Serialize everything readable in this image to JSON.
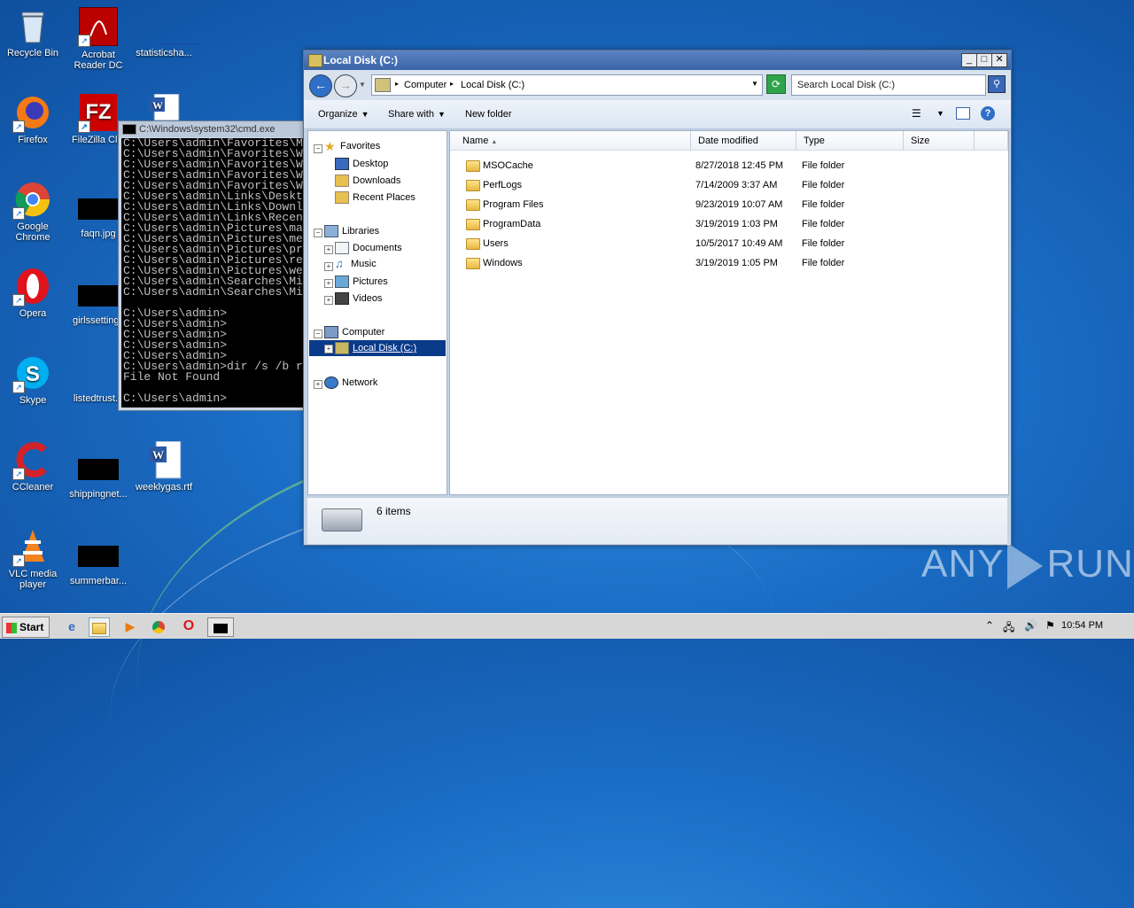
{
  "desktop": {
    "icons": [
      {
        "label": "Recycle Bin",
        "icon": "recycle-bin-icon"
      },
      {
        "label": "Acrobat Reader DC",
        "icon": "acrobat-icon"
      },
      {
        "label": "statisticsha...",
        "icon": "file-icon"
      },
      {
        "label": "Firefox",
        "icon": "firefox-icon"
      },
      {
        "label": "FileZilla Clie",
        "icon": "filezilla-icon"
      },
      {
        "label": "Google Chrome",
        "icon": "chrome-icon"
      },
      {
        "label": "faqn.jpg",
        "icon": "file-icon"
      },
      {
        "label": "Opera",
        "icon": "opera-icon"
      },
      {
        "label": "girlssettings",
        "icon": "file-icon"
      },
      {
        "label": "Skype",
        "icon": "skype-icon"
      },
      {
        "label": "listedtrust.p",
        "icon": "file-icon"
      },
      {
        "label": "CCleaner",
        "icon": "ccleaner-icon"
      },
      {
        "label": "shippingnet...",
        "icon": "file-icon"
      },
      {
        "label": "weeklygas.rtf",
        "icon": "word-doc-icon"
      },
      {
        "label": "VLC media player",
        "icon": "vlc-icon"
      },
      {
        "label": "summerbar...",
        "icon": "file-icon"
      }
    ]
  },
  "cmd": {
    "title": "C:\\Windows\\system32\\cmd.exe",
    "lines": "C:\\Users\\admin\\Favorites\\M\nC:\\Users\\admin\\Favorites\\W\nC:\\Users\\admin\\Favorites\\W\nC:\\Users\\admin\\Favorites\\W\nC:\\Users\\admin\\Favorites\\W\nC:\\Users\\admin\\Links\\Deskt\nC:\\Users\\admin\\Links\\Downl\nC:\\Users\\admin\\Links\\Recen\nC:\\Users\\admin\\Pictures\\ma\nC:\\Users\\admin\\Pictures\\me\nC:\\Users\\admin\\Pictures\\pr\nC:\\Users\\admin\\Pictures\\re\nC:\\Users\\admin\\Pictures\\we\nC:\\Users\\admin\\Searches\\Mi\nC:\\Users\\admin\\Searches\\Mi\n\nC:\\Users\\admin>\nC:\\Users\\admin>\nC:\\Users\\admin>\nC:\\Users\\admin>\nC:\\Users\\admin>\nC:\\Users\\admin>dir /s /b r\nFile Not Found\n\nC:\\Users\\admin>"
  },
  "explorer": {
    "title": "Local Disk (C:)",
    "breadcrumb": [
      "Computer",
      "Local Disk (C:)"
    ],
    "search_placeholder": "Search Local Disk (C:)",
    "toolbar": {
      "organize": "Organize",
      "share_with": "Share with",
      "new_folder": "New folder"
    },
    "nav": {
      "favorites": "Favorites",
      "desktop": "Desktop",
      "downloads": "Downloads",
      "recent_places": "Recent Places",
      "libraries": "Libraries",
      "documents": "Documents",
      "music": "Music",
      "pictures": "Pictures",
      "videos": "Videos",
      "computer": "Computer",
      "local_disk": "Local Disk (C:)",
      "network": "Network"
    },
    "columns": {
      "name": "Name",
      "date_modified": "Date modified",
      "type": "Type",
      "size": "Size"
    },
    "rows": [
      {
        "name": "MSOCache",
        "date": "8/27/2018 12:45 PM",
        "type": "File folder"
      },
      {
        "name": "PerfLogs",
        "date": "7/14/2009 3:37 AM",
        "type": "File folder"
      },
      {
        "name": "Program Files",
        "date": "9/23/2019 10:07 AM",
        "type": "File folder"
      },
      {
        "name": "ProgramData",
        "date": "3/19/2019 1:03 PM",
        "type": "File folder"
      },
      {
        "name": "Users",
        "date": "10/5/2017 10:49 AM",
        "type": "File folder"
      },
      {
        "name": "Windows",
        "date": "3/19/2019 1:05 PM",
        "type": "File folder"
      }
    ],
    "item_count": "6 items"
  },
  "taskbar": {
    "start": "Start",
    "clock": "10:54 PM"
  },
  "watermark": {
    "left": "ANY",
    "right": "RUN"
  }
}
